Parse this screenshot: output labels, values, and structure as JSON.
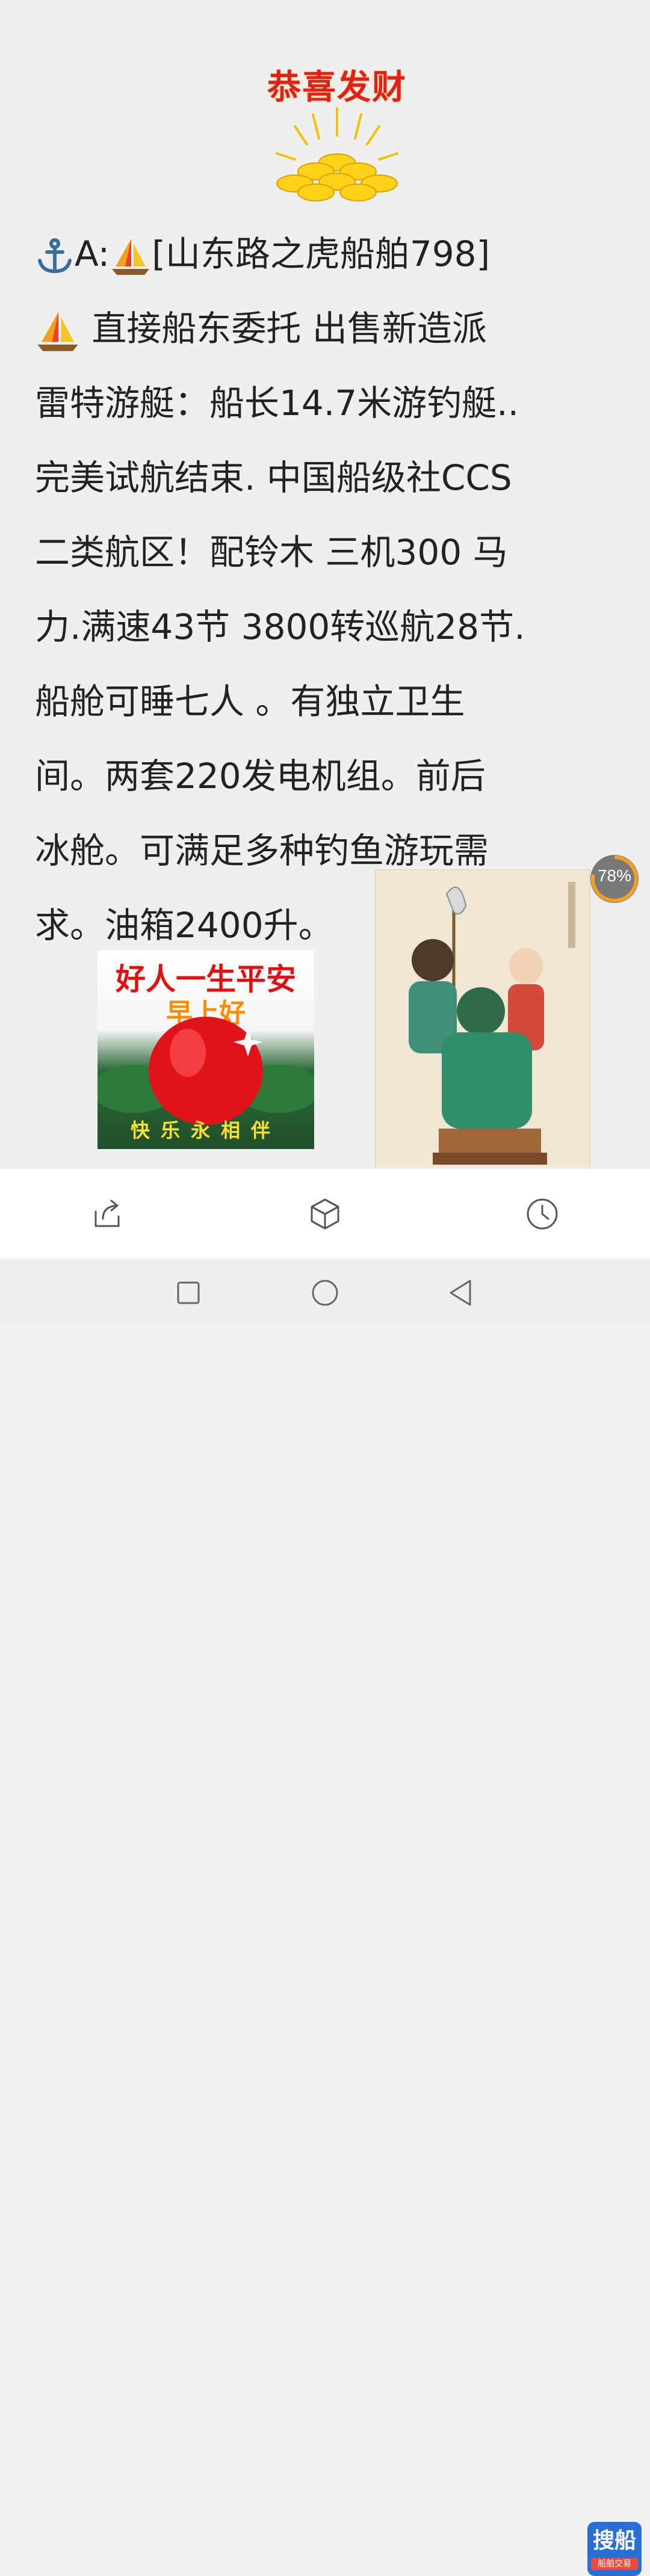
{
  "greeting_image": {
    "title": "恭喜发财",
    "icon": "gold-ingots-icon"
  },
  "article": {
    "line1_prefix": "A:",
    "line1_text": "[山东路之虎船舶798]",
    "line2_text": " 直接船东委托 出售新造派",
    "lines": [
      "雷特游艇：船长14.7米游钓艇..",
      "完美试航结束. 中国船级社CCS",
      "二类航区！配铃木 三机300 马",
      "力.满速43节 3800转巡航28节.",
      "船舱可睡七人 。有独立卫生",
      "间。两套220发电机组。前后",
      "冰舱。可满足多种钓鱼游玩需",
      "求。油箱2400升。"
    ]
  },
  "apple_image": {
    "top_text": "好人一生平安",
    "mid_text": "早上好",
    "bottom_text": "快乐永相伴"
  },
  "progress": {
    "label": "78%",
    "value": 0.78
  },
  "toolbar": {
    "share_icon": "share-icon",
    "box_icon": "cube-icon",
    "clock_icon": "clock-icon"
  },
  "brand": {
    "name": "搜船",
    "sub": "船舶交易"
  },
  "colors": {
    "accent_red": "#e02020",
    "brand_blue": "#2a6fd6"
  }
}
